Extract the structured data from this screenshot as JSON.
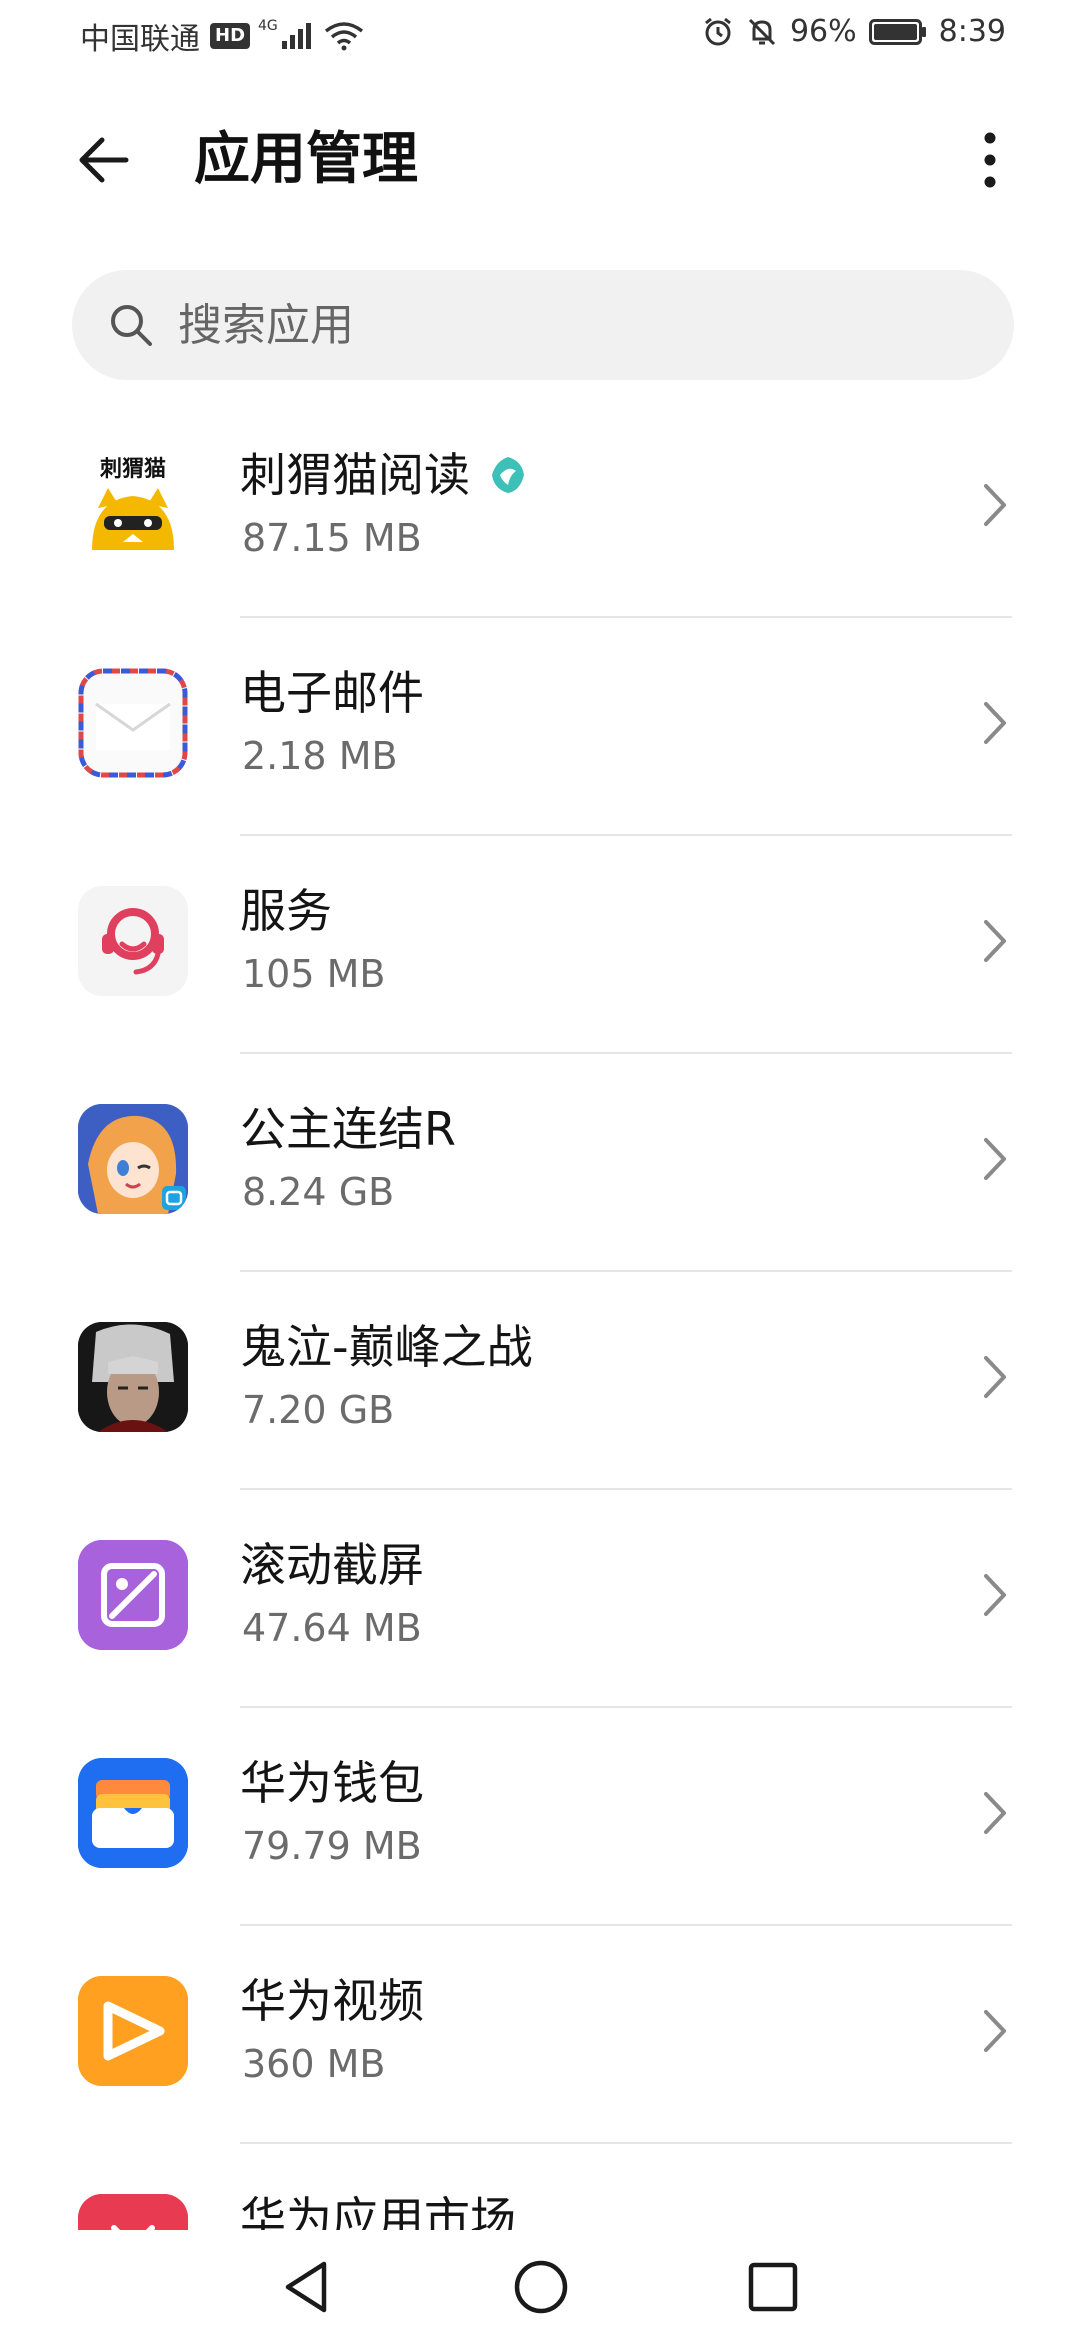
{
  "status_bar": {
    "carrier": "中国联通",
    "hd": "HD",
    "network": "4G",
    "battery": "96%",
    "time": "8:39"
  },
  "header": {
    "title": "应用管理"
  },
  "search": {
    "placeholder": "搜索应用"
  },
  "apps": [
    {
      "name": "刺猬猫阅读",
      "size": "87.15 MB",
      "icon": "cihuimao-icon",
      "icon_text": "刺猬猫"
    },
    {
      "name": "电子邮件",
      "size": "2.18 MB",
      "icon": "email-icon"
    },
    {
      "name": "服务",
      "size": "105 MB",
      "icon": "service-icon"
    },
    {
      "name": "公主连结R",
      "size": "8.24 GB",
      "icon": "princess-connect-icon"
    },
    {
      "name": "鬼泣-巅峰之战",
      "size": "7.20 GB",
      "icon": "devil-may-cry-icon"
    },
    {
      "name": "滚动截屏",
      "size": "47.64 MB",
      "icon": "scroll-screenshot-icon"
    },
    {
      "name": "华为钱包",
      "size": "79.79 MB",
      "icon": "huawei-wallet-icon"
    },
    {
      "name": "华为视频",
      "size": "360 MB",
      "icon": "huawei-video-icon"
    },
    {
      "name": "华为应用市场",
      "size": "",
      "icon": "huawei-appgallery-icon"
    }
  ],
  "colors": {
    "divider": "#e6e6e6",
    "search_bg": "#f1f1f1",
    "secondary_text": "#6b6b6b"
  }
}
